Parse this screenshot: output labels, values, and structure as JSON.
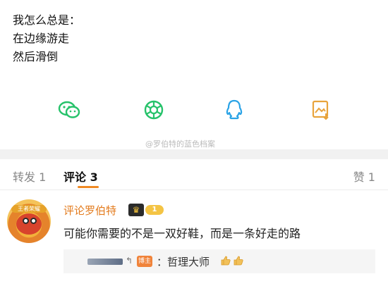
{
  "post": {
    "lines": [
      "我怎么总是：",
      "在边缘游走",
      "然后滑倒"
    ]
  },
  "share": {
    "items": [
      {
        "icon": "wechat-icon",
        "color": "#26c26a"
      },
      {
        "icon": "moments-icon",
        "color": "#26c26a"
      },
      {
        "icon": "qq-icon",
        "color": "#2aa3e6"
      },
      {
        "icon": "save-image-icon",
        "color": "#e8a33b"
      }
    ]
  },
  "watermark": "@罗伯特的蓝色档案",
  "tabs": {
    "repost": "转发 1",
    "comment": "评论 3",
    "like": "赞 1"
  },
  "comment": {
    "avatar_text": "王者荣耀",
    "username": "评论罗伯特",
    "level": "1",
    "text": "可能你需要的不是一双好鞋，而是一条好走的路",
    "reply": {
      "badge": "博主",
      "text": "：哲理大师"
    }
  },
  "colors": {
    "accent": "#f08a24",
    "username": "#e37b1d",
    "separator": "#f1f1f1"
  }
}
